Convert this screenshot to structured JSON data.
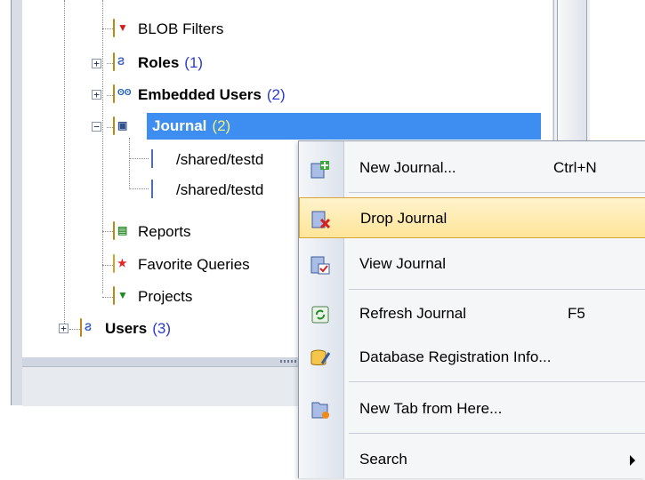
{
  "tree": {
    "items": [
      {
        "label": "BLOB Filters",
        "icon": "blob-filters-folder-icon"
      },
      {
        "label": "Roles",
        "count": "(1)",
        "icon": "roles-folder-icon"
      },
      {
        "label": "Embedded Users",
        "count": "(2)",
        "icon": "embedded-users-folder-icon"
      },
      {
        "label": "Journal",
        "count": "(2)",
        "icon": "journal-folder-icon"
      },
      {
        "label": "/shared/testd",
        "icon": "journal-file-icon"
      },
      {
        "label": "/shared/testd",
        "icon": "journal-file-icon"
      },
      {
        "label": "Reports",
        "icon": "reports-folder-icon"
      },
      {
        "label": "Favorite Queries",
        "icon": "favorite-queries-folder-icon"
      },
      {
        "label": "Projects",
        "icon": "projects-folder-icon"
      },
      {
        "label": "Users",
        "count": "(3)",
        "icon": "users-folder-icon"
      }
    ]
  },
  "context_menu": {
    "items": [
      {
        "label": "New Journal...",
        "shortcut": "Ctrl+N",
        "icon": "new-journal-icon"
      },
      {
        "label": "Drop Journal",
        "shortcut": "",
        "icon": "drop-journal-icon"
      },
      {
        "label": "View Journal",
        "shortcut": "",
        "icon": "view-journal-icon"
      },
      {
        "label": "Refresh Journal",
        "shortcut": "F5",
        "icon": "refresh-icon"
      },
      {
        "label": "Database Registration Info...",
        "shortcut": "",
        "icon": "database-registration-icon"
      },
      {
        "label": "New Tab from Here...",
        "shortcut": "",
        "icon": "new-tab-icon"
      },
      {
        "label": "Search",
        "shortcut": "",
        "icon": "submenu-arrow-icon"
      }
    ]
  },
  "colors": {
    "selection": "#3d8ef0",
    "count_text": "#2a3bd1",
    "menu_highlight": "#ffe59a"
  }
}
